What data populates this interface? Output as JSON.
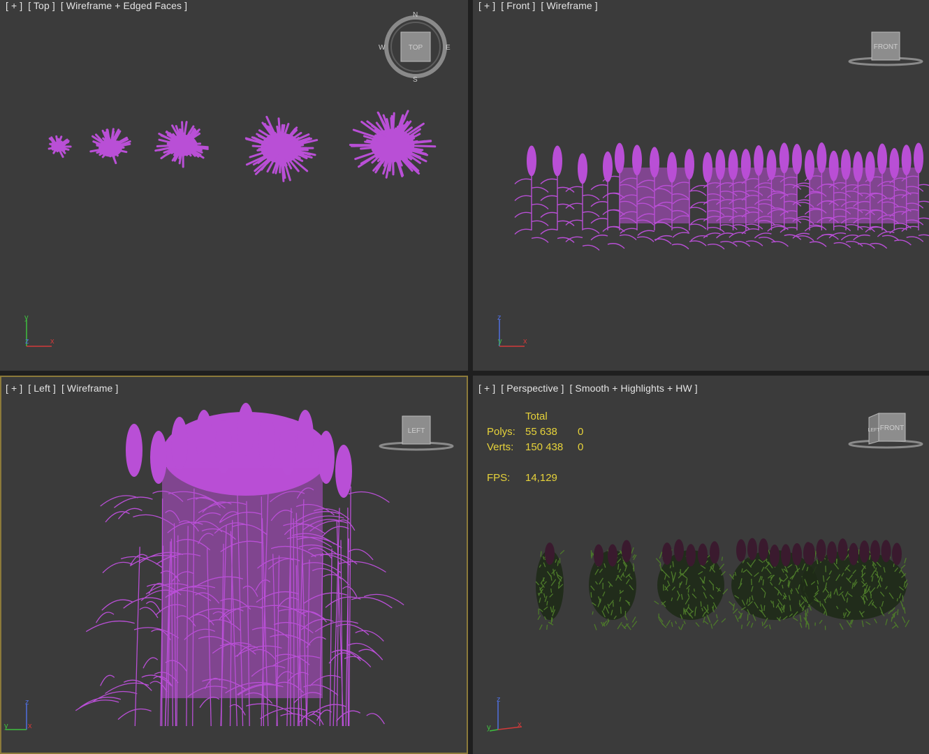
{
  "viewports": {
    "top": {
      "label": [
        "[ + ]",
        "[ Top ]",
        "[ Wireframe + Edged Faces ]"
      ],
      "cube_label": "TOP",
      "compass": {
        "n": "N",
        "s": "S",
        "e": "E",
        "w": "W"
      },
      "axes": {
        "vertical": "y",
        "corner": "z",
        "horizontal": "x"
      }
    },
    "front": {
      "label": [
        "[ + ]",
        "[ Front ]",
        "[ Wireframe ]"
      ],
      "cube_label": "FRONT",
      "axes": {
        "vertical": "z",
        "corner": "y",
        "horizontal": "x"
      }
    },
    "left": {
      "label": [
        "[ + ]",
        "[ Left ]",
        "[ Wireframe ]"
      ],
      "cube_label": "LEFT",
      "axes": {
        "vertical": "z",
        "corner": "x",
        "horizontal": "y"
      }
    },
    "perspective": {
      "label": [
        "[ + ]",
        "[ Perspective ]",
        "[ Smooth + Highlights + HW ]"
      ],
      "cube_label": "FRONT",
      "cube_side_label": "LEFT",
      "axes": {
        "vertical": "z",
        "corner": "x",
        "horizontal": "y"
      },
      "stats": {
        "header": "Total",
        "polys_label": "Polys:",
        "polys_total": "55 638",
        "polys_sel": "0",
        "verts_label": "Verts:",
        "verts_total": "150 438",
        "verts_sel": "0",
        "fps_label": "FPS:",
        "fps_value": "14,129"
      }
    }
  },
  "colors": {
    "wire": "#b94fd6",
    "stem": "#4d7a2a",
    "bloom": "#3a1a2e",
    "viewport_bg": "#3b3b3b",
    "active_border": "#8c7a3a",
    "stats_text": "#e6d23a"
  }
}
